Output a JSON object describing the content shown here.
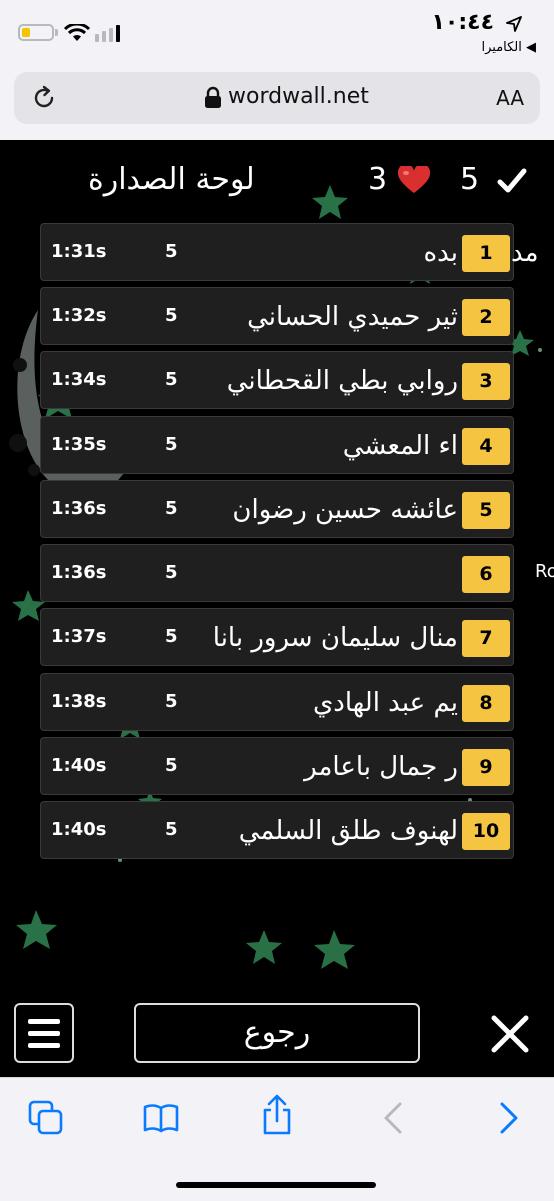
{
  "status_bar": {
    "time": "١٠:٤٤",
    "back_to_app": "◀ الكاميرا",
    "battery_level": 0.3,
    "battery_color": "#f5c400"
  },
  "browser": {
    "url": "wordwall.net",
    "text_size_label": "AA",
    "icons": [
      "reload-icon",
      "lock-icon"
    ]
  },
  "leaderboard": {
    "title": "لوحة الصدارة",
    "lives": "3",
    "score": "5",
    "rank_color": "#f5c542",
    "rows": [
      {
        "rank": "1",
        "name": "بده",
        "score": "5",
        "time": "1:31s",
        "overflow": "مد"
      },
      {
        "rank": "2",
        "name": "ثير حميدي الحساني",
        "score": "5",
        "time": "1:32s",
        "overflow": ""
      },
      {
        "rank": "3",
        "name": "روابي بطي القحطاني",
        "score": "5",
        "time": "1:34s",
        "overflow": ""
      },
      {
        "rank": "4",
        "name": "اء المعشي",
        "score": "5",
        "time": "1:35s",
        "overflow": ""
      },
      {
        "rank": "5",
        "name": "عائشه حسين رضوان",
        "score": "5",
        "time": "1:36s",
        "overflow": ""
      },
      {
        "rank": "6",
        "name": "",
        "score": "5",
        "time": "1:36s",
        "overflow": "Ro"
      },
      {
        "rank": "7",
        "name": "منال سليمان سرور بانا",
        "score": "5",
        "time": "1:37s",
        "overflow": ""
      },
      {
        "rank": "8",
        "name": "يم عبد الهادي",
        "score": "5",
        "time": "1:38s",
        "overflow": ""
      },
      {
        "rank": "9",
        "name": "ر جمال باعامر",
        "score": "5",
        "time": "1:40s",
        "overflow": ""
      },
      {
        "rank": "10",
        "name": "لهنوف طلق السلمي",
        "score": "5",
        "time": "1:40s",
        "overflow": ""
      }
    ]
  },
  "controls": {
    "back_label": "رجوع",
    "menu_icon": "menu-icon",
    "close_icon": "close-icon"
  },
  "toolbar": {
    "icons": [
      "tabs-icon",
      "bookmarks-icon",
      "share-icon",
      "back-icon",
      "forward-icon"
    ],
    "accent": "#0a7aff"
  }
}
